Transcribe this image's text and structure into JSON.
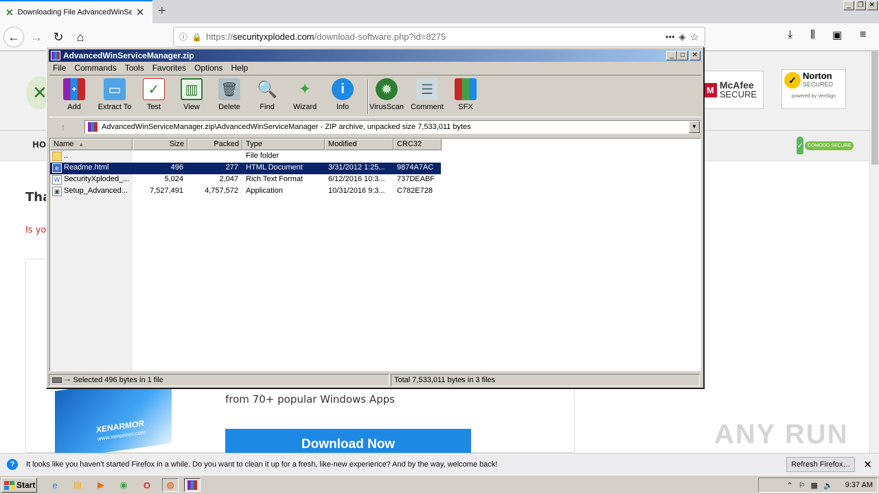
{
  "browser": {
    "tab_title": "Downloading File AdvancedWinSer",
    "url_prefix": "https://",
    "url_domain": "securityxploded.com",
    "url_path": "/download-software.php?id=8275",
    "more_icon": "•••"
  },
  "site": {
    "nav_home": "HO",
    "heading": "Tha",
    "subtext": "Is yo",
    "mcafee": "McAfee",
    "mcafee_sub": "SECURE",
    "norton": "Norton",
    "norton_sub": "SECURED",
    "norton_small": "powered by VeriSign",
    "comodo": "COMODO SECURE",
    "promo_text": "from 70+ popular Windows Apps",
    "download_btn": "Download Now",
    "xenarmor": "XENARMOR",
    "xenarmor_url": "www.xenarmor.com",
    "watermark": "ANY RUN"
  },
  "notification": {
    "message": "It looks like you haven’t started Firefox in a while. Do you want to clean it up for a fresh, like-new experience? And by the way, welcome back!",
    "button": "Refresh Firefox…"
  },
  "taskbar": {
    "start": "Start",
    "clock": "9:37 AM"
  },
  "winrar": {
    "title": "AdvancedWinServiceManager.zip",
    "menu": [
      "File",
      "Commands",
      "Tools",
      "Favorites",
      "Options",
      "Help"
    ],
    "tools": [
      "Add",
      "Extract To",
      "Test",
      "View",
      "Delete",
      "Find",
      "Wizard",
      "Info",
      "VirusScan",
      "Comment",
      "SFX"
    ],
    "path": "AdvancedWinServiceManager.zip\\AdvancedWinServiceManager - ZIP archive, unpacked size 7,533,011 bytes",
    "columns": [
      "Name",
      "Size",
      "Packed",
      "Type",
      "Modified",
      "CRC32"
    ],
    "rows": [
      {
        "name": "..",
        "size": "",
        "packed": "",
        "type": "File folder",
        "modified": "",
        "crc": ""
      },
      {
        "name": "Readme.html",
        "size": "496",
        "packed": "277",
        "type": "HTML Document",
        "modified": "3/31/2012 1:25...",
        "crc": "9874A7AC"
      },
      {
        "name": "SecurityXploded_...",
        "size": "5,024",
        "packed": "2,047",
        "type": "Rich Text Format",
        "modified": "6/12/2016 10:3...",
        "crc": "737DEABF"
      },
      {
        "name": "Setup_Advanced...",
        "size": "7,527,491",
        "packed": "4,757,572",
        "type": "Application",
        "modified": "10/31/2016 9:3...",
        "crc": "C782E728"
      }
    ],
    "status_left": "Selected 496 bytes in 1 file",
    "status_right": "Total 7,533,011 bytes in 3 files"
  }
}
